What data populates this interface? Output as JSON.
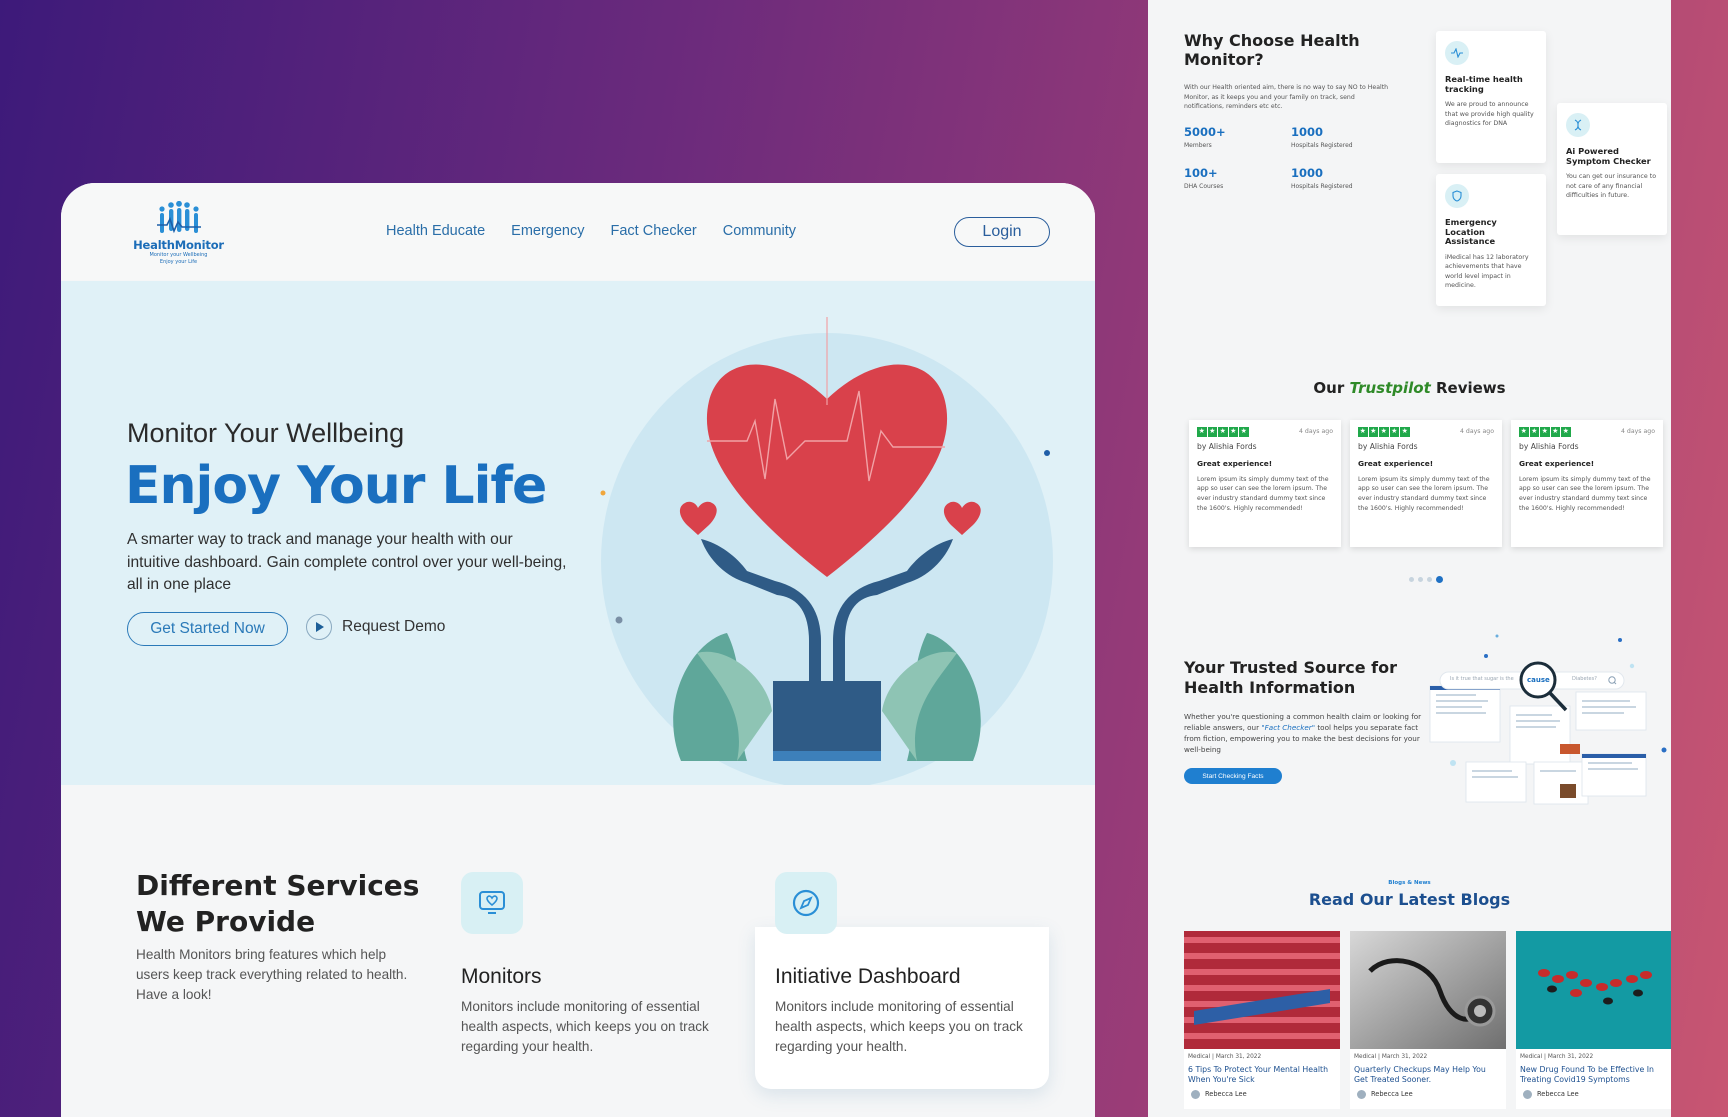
{
  "left": {
    "logo": {
      "name": "HealthMonitor",
      "tagline1": "Monitor your Wellbeing",
      "tagline2": "Enjoy your Life"
    },
    "nav": [
      "Health Educate",
      "Emergency",
      "Fact Checker",
      "Community"
    ],
    "login_label": "Login",
    "hero": {
      "subtitle": "Monitor Your Wellbeing",
      "title": "Enjoy Your Life",
      "description": "A smarter way to track and manage your health with our intuitive dashboard. Gain complete control over your well-being, all in one place",
      "primary_cta": "Get Started Now",
      "secondary_cta": "Request Demo"
    },
    "services": {
      "title_line1": "Different Services",
      "title_line2": "We Provide",
      "description": "Health Monitors bring features which help users keep track everything related to health. Have a look!",
      "cards": [
        {
          "title": "Monitors",
          "description": "Monitors include monitoring of essential health aspects, which keeps you on track regarding your health.",
          "icon": "monitor-heart-icon"
        },
        {
          "title": "Initiative Dashboard",
          "description": "Monitors include monitoring of essential health aspects, which keeps you on track regarding your health.",
          "icon": "compass-icon"
        }
      ]
    }
  },
  "right": {
    "why": {
      "title_line1": "Why Choose Health",
      "title_line2": "Monitor?",
      "description": "With our Health oriented aim, there is no way to say NO to Health Monitor, as it keeps you and your family on track, send notifications, reminders etc etc.",
      "stats": [
        {
          "value": "5000+",
          "label": "Members"
        },
        {
          "value": "1000",
          "label": "Hospitals Registered"
        },
        {
          "value": "100+",
          "label": "DHA Courses"
        },
        {
          "value": "1000",
          "label": "Hospitals Registered"
        }
      ],
      "features": [
        {
          "title": "Real-time health tracking",
          "description": "We are proud to announce that we provide high quality diagnostics for DNA",
          "icon": "pulse-icon"
        },
        {
          "title": "Ai Powered Symptom Checker",
          "description": "You can get our insurance to not care of any financial difficulties in future.",
          "icon": "dna-icon"
        },
        {
          "title": "Emergency Location Assistance",
          "description": "iMedical has 12 laboratory achievements that have world level impact in medicine.",
          "icon": "shield-icon"
        }
      ]
    },
    "reviews": {
      "title_pre": "Our ",
      "title_brand": "Trustpilot",
      "title_post": " Reviews",
      "items": [
        {
          "date": "4 days ago",
          "by": "by Alishia Fords",
          "headline": "Great experience!",
          "body": "Lorem ipsum its simply dummy text of the app so user can see the lorem ipsum. The ever industry standard dummy text since the 1600's. Highly recommended!"
        },
        {
          "date": "4 days ago",
          "by": "by Alishia Fords",
          "headline": "Great experience!",
          "body": "Lorem ipsum its simply dummy text of the app so user can see the lorem ipsum. The ever industry standard dummy text since the 1600's. Highly recommended!"
        },
        {
          "date": "4 days ago",
          "by": "by Alishia Fords",
          "headline": "Great experience!",
          "body": "Lorem ipsum its simply dummy text of the app so user can see the lorem ipsum. The ever industry standard dummy text since the 1600's. Highly recommended!"
        }
      ]
    },
    "trusted": {
      "title_line1": "Your Trusted Source for",
      "title_line2": "Health Information",
      "desc_pre": "Whether you're questioning a common health claim or looking for reliable answers, our ",
      "desc_link": "\"Fact Checker\"",
      "desc_post": " tool helps you separate fact from fiction, empowering you to make the best decisions for your well-being",
      "cta": "Start Checking Facts",
      "search_text": "Is it true that sugar is the",
      "search_highlight": "cause",
      "search_tail": "Diabetes?"
    },
    "blogs": {
      "kicker": "Blogs & News",
      "title": "Read Our Latest Blogs",
      "items": [
        {
          "category": "Medical",
          "date": "March 31, 2022",
          "title": "6 Tips To Protect Your Mental Health When You're Sick",
          "author": "Rebecca Lee"
        },
        {
          "category": "Medical",
          "date": "March 31, 2022",
          "title": "Quarterly Checkups May Help You Get Treated Sooner.",
          "author": "Rebecca Lee"
        },
        {
          "category": "Medical",
          "date": "March 31, 2022",
          "title": "New Drug Found To be Effective In Treating Covid19 Symptoms",
          "author": "Rebecca Lee"
        }
      ]
    }
  }
}
